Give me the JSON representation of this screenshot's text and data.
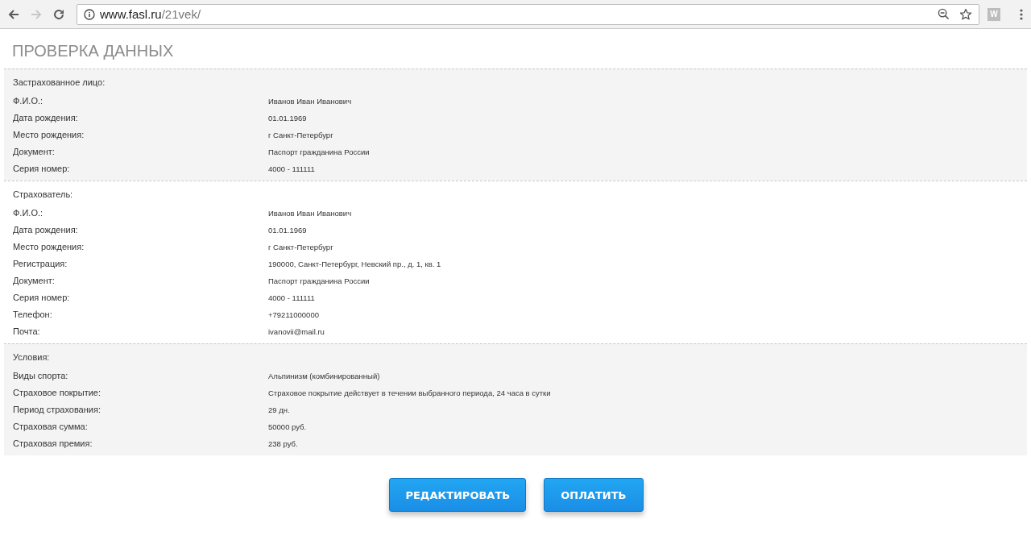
{
  "browser": {
    "url_host": "www.fasl.ru",
    "url_path": "/21vek/",
    "extension_label": "W"
  },
  "page_title": "ПРОВЕРКА ДАННЫХ",
  "sections": [
    {
      "heading": "Застрахованное лицо:",
      "rows": [
        {
          "label": "Ф.И.О.:",
          "value": "Иванов Иван Иванович"
        },
        {
          "label": "Дата рождения:",
          "value": "01.01.1969"
        },
        {
          "label": "Место рождения:",
          "value": "г Санкт-Петербург"
        },
        {
          "label": "Документ:",
          "value": "Паспорт гражданина России"
        },
        {
          "label": "Серия номер:",
          "value": "4000 - 111111"
        }
      ]
    },
    {
      "heading": "Страхователь:",
      "rows": [
        {
          "label": "Ф.И.О.:",
          "value": "Иванов Иван Иванович"
        },
        {
          "label": "Дата рождения:",
          "value": "01.01.1969"
        },
        {
          "label": "Место рождения:",
          "value": "г Санкт-Петербург"
        },
        {
          "label": "Регистрация:",
          "value": "190000, Санкт-Петербург, Невский пр., д. 1, кв. 1"
        },
        {
          "label": "Документ:",
          "value": "Паспорт гражданина России"
        },
        {
          "label": "Серия номер:",
          "value": "4000 - 111111"
        },
        {
          "label": "Телефон:",
          "value": "+79211000000"
        },
        {
          "label": "Почта:",
          "value": "ivanovii@mail.ru"
        }
      ]
    },
    {
      "heading": "Условия:",
      "rows": [
        {
          "label": "Виды спорта:",
          "value": "Альпинизм (комбинированный)"
        },
        {
          "label": "Страховое покрытие:",
          "value": "Страховое покрытие действует в течении выбранного периода, 24 часа в сутки"
        },
        {
          "label": "Период страхования:",
          "value": "29 дн."
        },
        {
          "label": "Страховая сумма:",
          "value": "50000 руб."
        },
        {
          "label": "Страховая премия:",
          "value": "238 руб."
        }
      ]
    }
  ],
  "buttons": [
    "РЕДАКТИРОВАТЬ",
    "ОПЛАТИТЬ"
  ]
}
